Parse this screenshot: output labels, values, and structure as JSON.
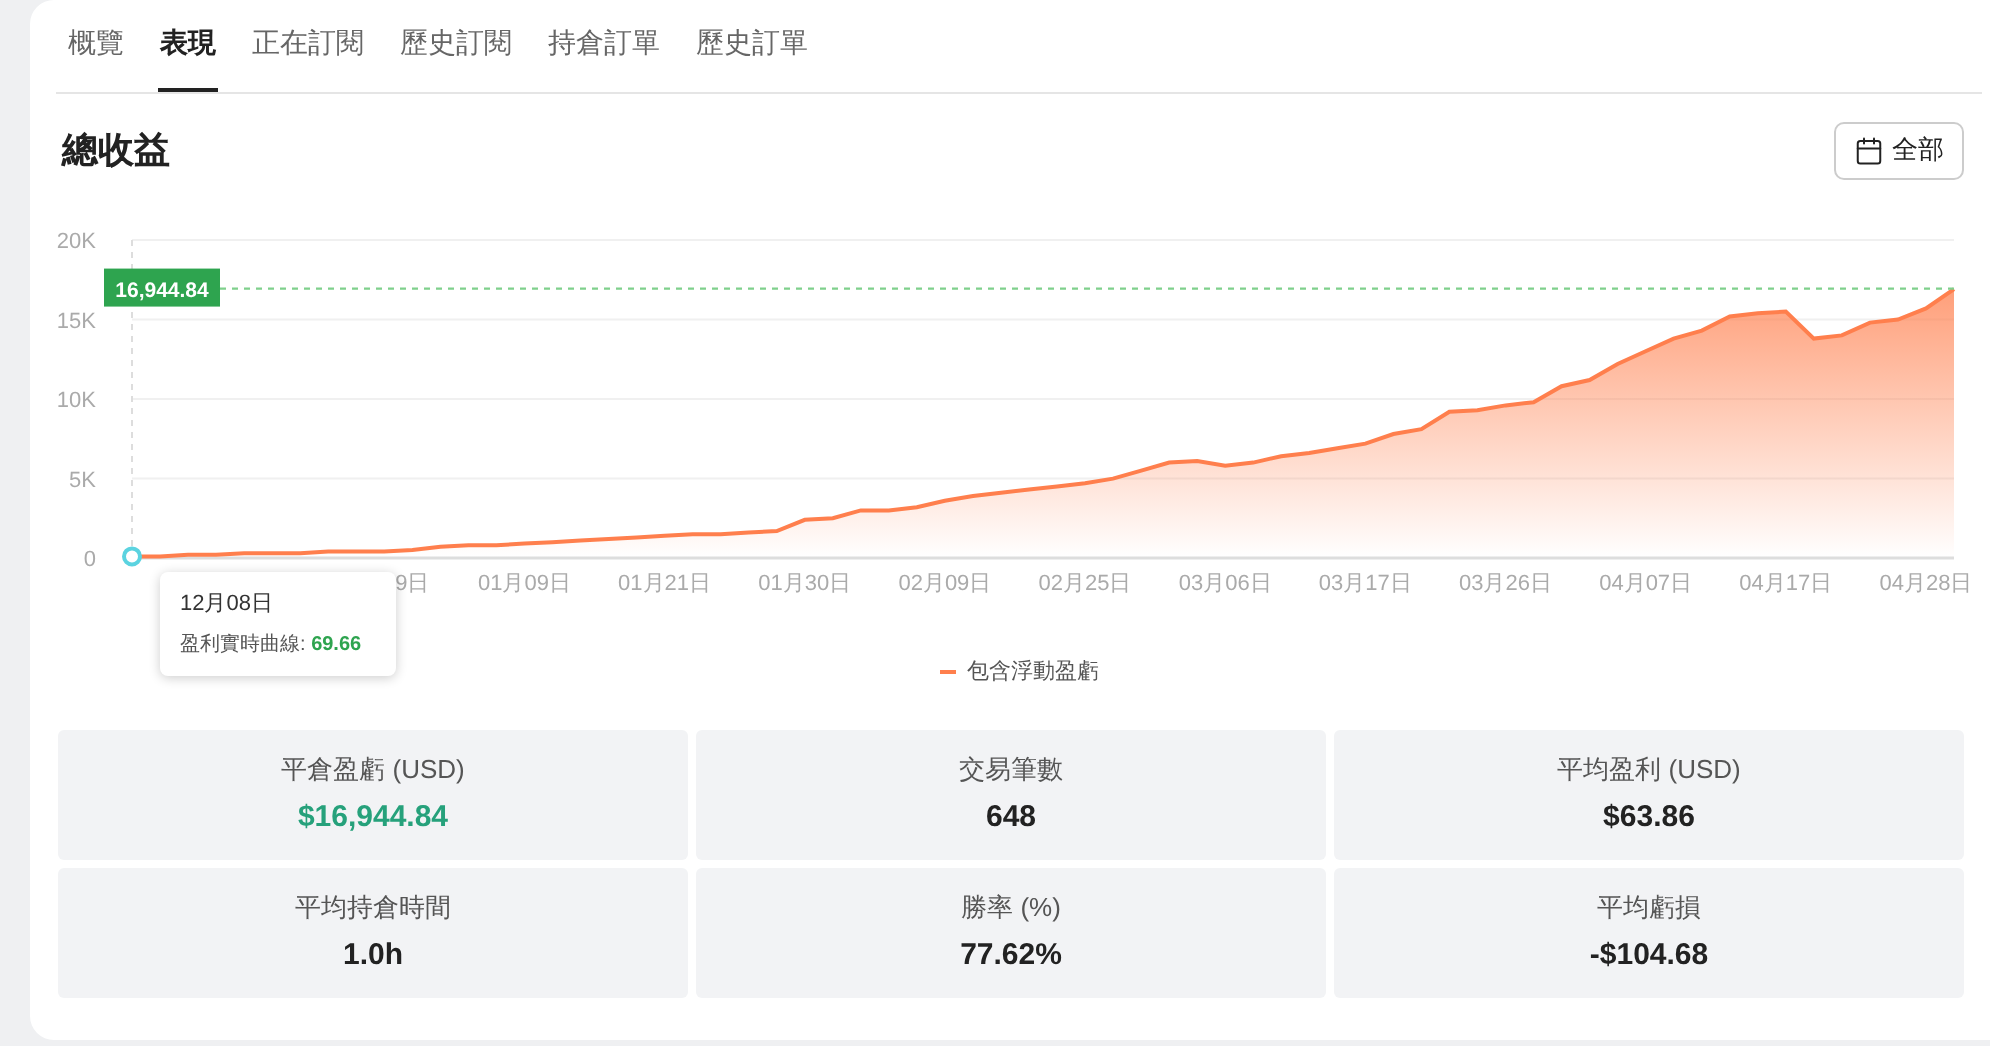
{
  "tabs": [
    {
      "label": "概覽",
      "selected": false
    },
    {
      "label": "表現",
      "selected": true
    },
    {
      "label": "正在訂閱",
      "selected": false
    },
    {
      "label": "歷史訂閱",
      "selected": false
    },
    {
      "label": "持倉訂單",
      "selected": false
    },
    {
      "label": "歷史訂單",
      "selected": false
    }
  ],
  "section_title": "總收益",
  "range_button": {
    "label": "全部"
  },
  "chart": {
    "chart_data": {
      "type": "area",
      "categories": [
        null,
        null,
        null,
        null,
        null,
        null,
        null,
        null,
        null,
        null,
        "9日",
        null,
        null,
        null,
        "01月09日",
        null,
        null,
        null,
        null,
        "01月21日",
        null,
        null,
        null,
        null,
        "01月30日",
        null,
        null,
        null,
        null,
        "02月09日",
        null,
        null,
        null,
        null,
        "02月25日",
        null,
        null,
        null,
        null,
        "03月06日",
        null,
        null,
        null,
        null,
        "03月17日",
        null,
        null,
        null,
        null,
        "03月26日",
        null,
        null,
        null,
        null,
        "04月07日",
        null,
        null,
        null,
        null,
        "04月17日",
        null,
        null,
        null,
        null,
        "04月28日",
        null
      ],
      "series": [
        {
          "name": "包含浮動盈虧",
          "color": "#ff7f4d",
          "values": [
            100,
            100,
            200,
            200,
            300,
            300,
            300,
            400,
            400,
            400,
            500,
            700,
            800,
            800,
            900,
            1000,
            1100,
            1200,
            1300,
            1400,
            1500,
            1500,
            1600,
            1700,
            2400,
            2500,
            3000,
            3000,
            3200,
            3600,
            3900,
            4100,
            4300,
            4500,
            4700,
            5000,
            5500,
            6000,
            6100,
            5800,
            6000,
            6400,
            6600,
            6900,
            7200,
            7800,
            8100,
            9200,
            9300,
            9600,
            9800,
            10800,
            11200,
            12200,
            13000,
            13800,
            14300,
            15200,
            15400,
            15500,
            13800,
            14000,
            14800,
            15000,
            15700,
            16900
          ]
        }
      ],
      "grid": true,
      "ylim": [
        0,
        20000
      ],
      "yticks": [
        {
          "value": 0,
          "label": "0"
        },
        {
          "value": 5000,
          "label": "5K"
        },
        {
          "value": 10000,
          "label": "10K"
        },
        {
          "value": 15000,
          "label": "15K"
        },
        {
          "value": 20000,
          "label": "20K"
        }
      ],
      "ref_lines": [
        {
          "axis": "y",
          "value": 16944.84,
          "label": "16,944.84"
        }
      ]
    },
    "tooltip": {
      "date": "12月08日",
      "label": "盈利實時曲線:",
      "value": "69.66"
    }
  },
  "stats": [
    {
      "label": "平倉盈虧 (USD)",
      "value": "$16,944.84",
      "color": "#26a17b"
    },
    {
      "label": "交易筆數",
      "value": "648",
      "color": "#222222"
    },
    {
      "label": "平均盈利 (USD)",
      "value": "$63.86",
      "color": "#222222"
    },
    {
      "label": "平均持倉時間",
      "value": "1.0h",
      "color": "#222222"
    },
    {
      "label": "勝率 (%)",
      "value": "77.62%",
      "color": "#222222"
    },
    {
      "label": "平均虧損",
      "value": "-$104.68",
      "color": "#222222"
    }
  ]
}
